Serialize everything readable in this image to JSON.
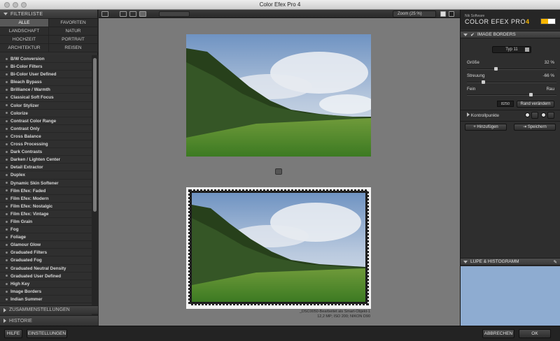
{
  "window": {
    "title": "Color Efex Pro 4"
  },
  "left_panel": {
    "filterlist_header": "FILTERLISTE",
    "categories": [
      "ALLE",
      "FAVORITEN",
      "LANDSCHAFT",
      "NATUR",
      "HOCHZEIT",
      "PORTRAIT",
      "ARCHITEKTUR",
      "REISEN"
    ],
    "active_category": "ALLE",
    "filters": [
      "B/W Conversion",
      "Bi-Color Filters",
      "Bi-Color User Defined",
      "Bleach Bypass",
      "Brilliance / Warmth",
      "Classical Soft Focus",
      "Color Stylizer",
      "Colorize",
      "Contrast Color Range",
      "Contrast Only",
      "Cross Balance",
      "Cross Processing",
      "Dark Contrasts",
      "Darken / Lighten Center",
      "Detail Extractor",
      "Duplex",
      "Dynamic Skin Softener",
      "Film Efex: Faded",
      "Film Efex: Modern",
      "Film Efex: Nostalgic",
      "Film Efex: Vintage",
      "Film Grain",
      "Fog",
      "Foliage",
      "Glamour Glow",
      "Graduated Filters",
      "Graduated Fog",
      "Graduated Neutral Density",
      "Graduated User Defined",
      "High Key",
      "Image Borders",
      "Indian Summer"
    ],
    "zusammenstellungen": "ZUSAMMENSTELLUNGEN",
    "historie": "HISTORIE"
  },
  "bottom_bar": {
    "hilfe": "HILFE",
    "einstellungen": "EINSTELLUNGEN",
    "abbrechen": "ABBRECHEN",
    "ok": "OK"
  },
  "toolbar": {
    "zoom_label": "Zoom (25 %)"
  },
  "preview": {
    "caption_line1": "_DSC0050-Bearbeitet als Smart-Objekt-1",
    "caption_line2": "12,2 MP; ISO 200; NIKON D90"
  },
  "right_panel": {
    "nik": "Nik Software",
    "brand_prefix": "COLOR EFEX PRO",
    "brand_version": "4",
    "filter_title": "IMAGE BORDERS",
    "type_select": "Typ 11",
    "params": [
      {
        "label": "Größe",
        "value": "32",
        "unit": "%",
        "level": 0.32
      },
      {
        "label": "Streuung",
        "value": "-66",
        "unit": "%",
        "level": 0.17
      }
    ],
    "fein_label": "Fein",
    "rau_label": "Rau",
    "fein_rau_level": 0.72,
    "seed_value": "8250",
    "rand_button": "Rand verändern",
    "kontrollpunkte": "Kontrollpunkte",
    "hinzufuegen": "Hinzufügen",
    "speichern": "Speichern",
    "loupe_header": "LUPE & HISTOGRAMM"
  }
}
